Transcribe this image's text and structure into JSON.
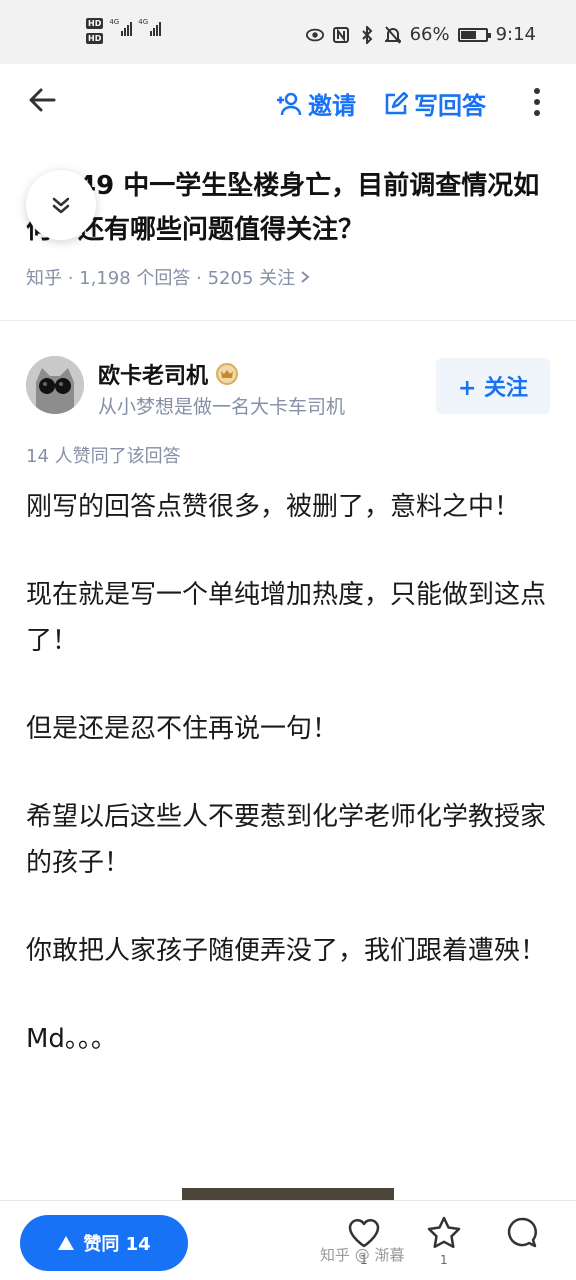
{
  "status_bar": {
    "hd_labels": [
      "HD",
      "HD"
    ],
    "signal_labels": [
      "4G",
      "4G"
    ],
    "battery_percent": 66,
    "battery_text": "66%",
    "time": "9:14"
  },
  "header": {
    "invite_label": "邀请",
    "write_answer_label": "写回答"
  },
  "question": {
    "title": "　　49 中一学生坠楼身亡，目前调查情况如何？还有哪些问题值得关注？",
    "meta": "知乎 · 1,198 个回答 · 5205 关注"
  },
  "author": {
    "name": "欧卡老司机",
    "bio": "从小梦想是做一名大卡车司机",
    "follow_label": "+ 关注"
  },
  "answer": {
    "upvote_note": "14 人赞同了该回答",
    "paragraphs": [
      "刚写的回答点赞很多，被删了，意料之中！",
      "现在就是写一个单纯增加热度，只能做到这点了！",
      "但是还是忍不住再说一句！",
      "希望以后这些人不要惹到化学老师化学教授家的孩子！",
      "你敢把人家孩子随便弄没了，我们跟着遭殃！",
      "Md。。。"
    ]
  },
  "bottom_bar": {
    "vote_label": "赞同 14",
    "like_count": "1",
    "favorite_count": "1"
  },
  "watermark": "知乎 @ 渐暮"
}
